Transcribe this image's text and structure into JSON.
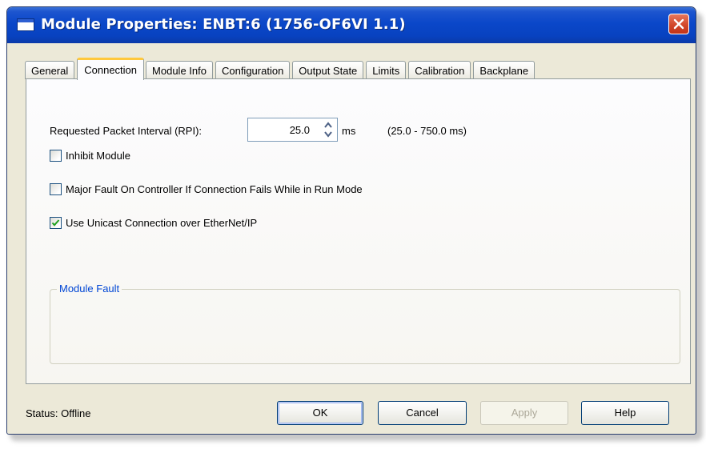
{
  "window": {
    "title": "Module Properties: ENBT:6 (1756-OF6VI 1.1)",
    "title_color": "#ffffff",
    "titlebar_color": "#0a47c9",
    "close_color": "#d2472a"
  },
  "tabs": [
    {
      "label": "General",
      "active": false
    },
    {
      "label": "Connection",
      "active": true
    },
    {
      "label": "Module Info",
      "active": false
    },
    {
      "label": "Configuration",
      "active": false
    },
    {
      "label": "Output State",
      "active": false
    },
    {
      "label": "Limits",
      "active": false
    },
    {
      "label": "Calibration",
      "active": false
    },
    {
      "label": "Backplane",
      "active": false
    }
  ],
  "connection": {
    "rpi_label": "Requested Packet Interval (RPI):",
    "rpi_value": "25.0",
    "rpi_unit": "ms",
    "rpi_range": "(25.0 - 750.0 ms)",
    "inhibit_label": "Inhibit Module",
    "inhibit_checked": false,
    "major_fault_label": "Major Fault On Controller If Connection Fails While in Run Mode",
    "major_fault_checked": false,
    "unicast_label": "Use Unicast Connection over EtherNet/IP",
    "unicast_checked": true,
    "module_fault_label": "Module Fault",
    "module_fault_color": "#0046d5"
  },
  "footer": {
    "status_label": "Status:",
    "status_value": "Offline",
    "ok_label": "OK",
    "cancel_label": "Cancel",
    "apply_label": "Apply",
    "apply_enabled": false,
    "help_label": "Help"
  }
}
